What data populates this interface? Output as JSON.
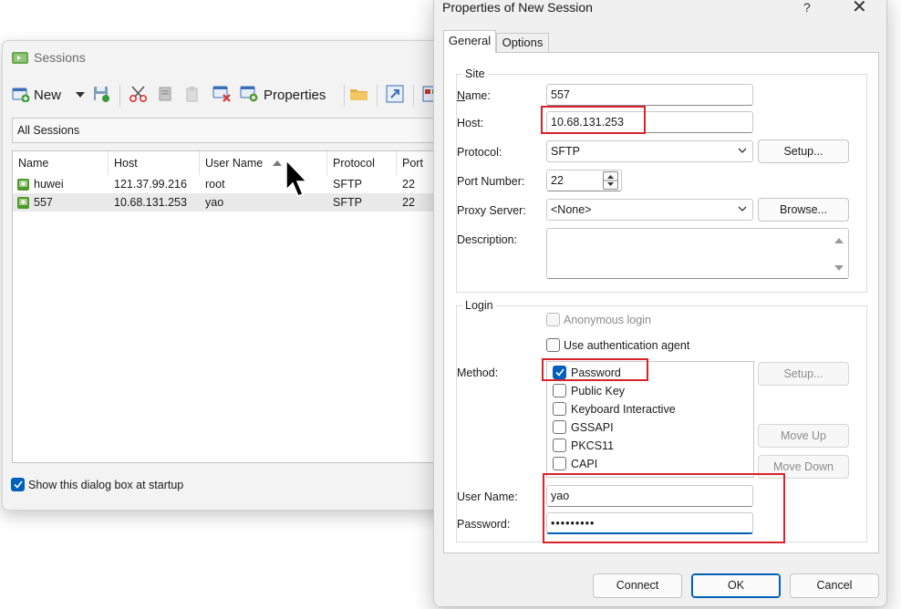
{
  "sessions_window": {
    "title": "Sessions",
    "toolbar": {
      "new_label": "New",
      "properties_label": "Properties"
    },
    "combo_value": "All Sessions",
    "columns": [
      "Name",
      "Host",
      "User Name",
      "Protocol",
      "Port"
    ],
    "rows": [
      {
        "name": "huwei",
        "host": "121.37.99.216",
        "user": "root",
        "protocol": "SFTP",
        "port": "22"
      },
      {
        "name": "557",
        "host": "10.68.131.253",
        "user": "yao",
        "protocol": "SFTP",
        "port": "22"
      }
    ],
    "show_at_startup_label": "Show this dialog box at startup",
    "show_at_startup_checked": true
  },
  "props_dialog": {
    "title": "Properties of New Session",
    "help_glyph": "?",
    "close_glyph": "✕",
    "tabs": [
      "General",
      "Options"
    ],
    "site": {
      "legend": "Site",
      "name_label": "Name:",
      "name_value": "557",
      "host_label": "Host:",
      "host_value": "10.68.131.253",
      "protocol_label": "Protocol:",
      "protocol_value": "SFTP",
      "setup_button": "Setup...",
      "port_label": "Port Number:",
      "port_value": "22",
      "proxy_label": "Proxy Server:",
      "proxy_value": "<None>",
      "browse_button": "Browse...",
      "description_label": "Description:"
    },
    "login": {
      "legend": "Login",
      "anonymous_label": "Anonymous login",
      "auth_agent_label": "Use authentication agent",
      "method_label": "Method:",
      "methods": [
        {
          "label": "Password",
          "checked": true
        },
        {
          "label": "Public Key",
          "checked": false
        },
        {
          "label": "Keyboard Interactive",
          "checked": false
        },
        {
          "label": "GSSAPI",
          "checked": false
        },
        {
          "label": "PKCS11",
          "checked": false
        },
        {
          "label": "CAPI",
          "checked": false
        }
      ],
      "setup_button": "Setup...",
      "move_up_button": "Move Up",
      "move_down_button": "Move Down",
      "username_label": "User Name:",
      "username_value": "yao",
      "password_label": "Password:",
      "password_value": "•••••••••"
    },
    "footer": {
      "connect": "Connect",
      "ok": "OK",
      "cancel": "Cancel"
    }
  },
  "colors": {
    "accent": "#005fb8",
    "highlight_red": "#d9222a",
    "session_green": "#4c9a2a"
  }
}
